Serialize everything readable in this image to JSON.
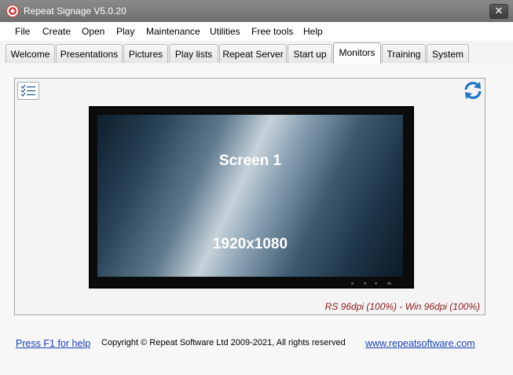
{
  "window": {
    "title": "Repeat Signage V5.0.20",
    "close_label": "✕"
  },
  "menu": [
    "File",
    "Create",
    "Open",
    "Play",
    "Maintenance",
    "Utilities",
    "Free tools",
    "Help"
  ],
  "tabs": [
    {
      "label": "Welcome",
      "active": false
    },
    {
      "label": "Presentations",
      "active": false
    },
    {
      "label": "Pictures",
      "active": false
    },
    {
      "label": "Play lists",
      "active": false
    },
    {
      "label": "Repeat Server",
      "active": false
    },
    {
      "label": "Start up",
      "active": false
    },
    {
      "label": "Monitors",
      "active": true
    },
    {
      "label": "Training",
      "active": false
    },
    {
      "label": "System",
      "active": false
    }
  ],
  "monitors_panel": {
    "icons": {
      "left": "checklist-icon",
      "right": "refresh-icon"
    },
    "screen": {
      "name": "Screen 1",
      "resolution": "1920x1080"
    },
    "dpi_info": "RS 96dpi (100%) - Win 96dpi (100%)"
  },
  "footer": {
    "help_link": "Press F1 for help",
    "copyright": "Copyright © Repeat Software Ltd 2009-2021, All rights reserved",
    "website_link": "www.repeatsoftware.com"
  },
  "colors": {
    "link": "#1a3fb5",
    "dpi_text": "#8b1a1a",
    "refresh_icon": "#1f78c8"
  }
}
